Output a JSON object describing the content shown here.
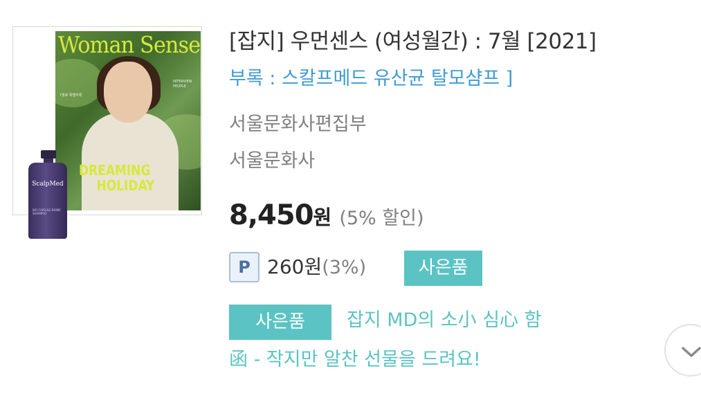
{
  "product": {
    "cover": {
      "magazine_title": "Woman Sense",
      "headline_line1": "DREAMING",
      "headline_line2": "HOLIDAY",
      "product_name": "ScalpMed",
      "product_subtext": "BIO CAPSULE BIOME SHAMPOO",
      "right_blurb": "INTERVIEW PEOPLE",
      "left_blurb": "7월호 특별부록"
    },
    "title": "[잡지] 우먼센스 (여성월간) : 7월 [2021]",
    "subtitle": "부록 : 스칼프메드 유산균 탈모샴프 ]",
    "author": "서울문화사편집부",
    "publisher": "서울문화사",
    "price": "8,450",
    "price_unit": "원",
    "discount": "(5% 할인)",
    "points_badge": "P",
    "points": "260원",
    "points_rate": "(3%)",
    "gift_tag_small": "사은품",
    "gift_tag": "사은품",
    "gift_desc_line1": "잡지 MD의 소小 심心 함",
    "gift_desc_line2": "函 - 작지만 알찬 선물을 드려요!",
    "expand_icon": "chevron-down-icon"
  }
}
